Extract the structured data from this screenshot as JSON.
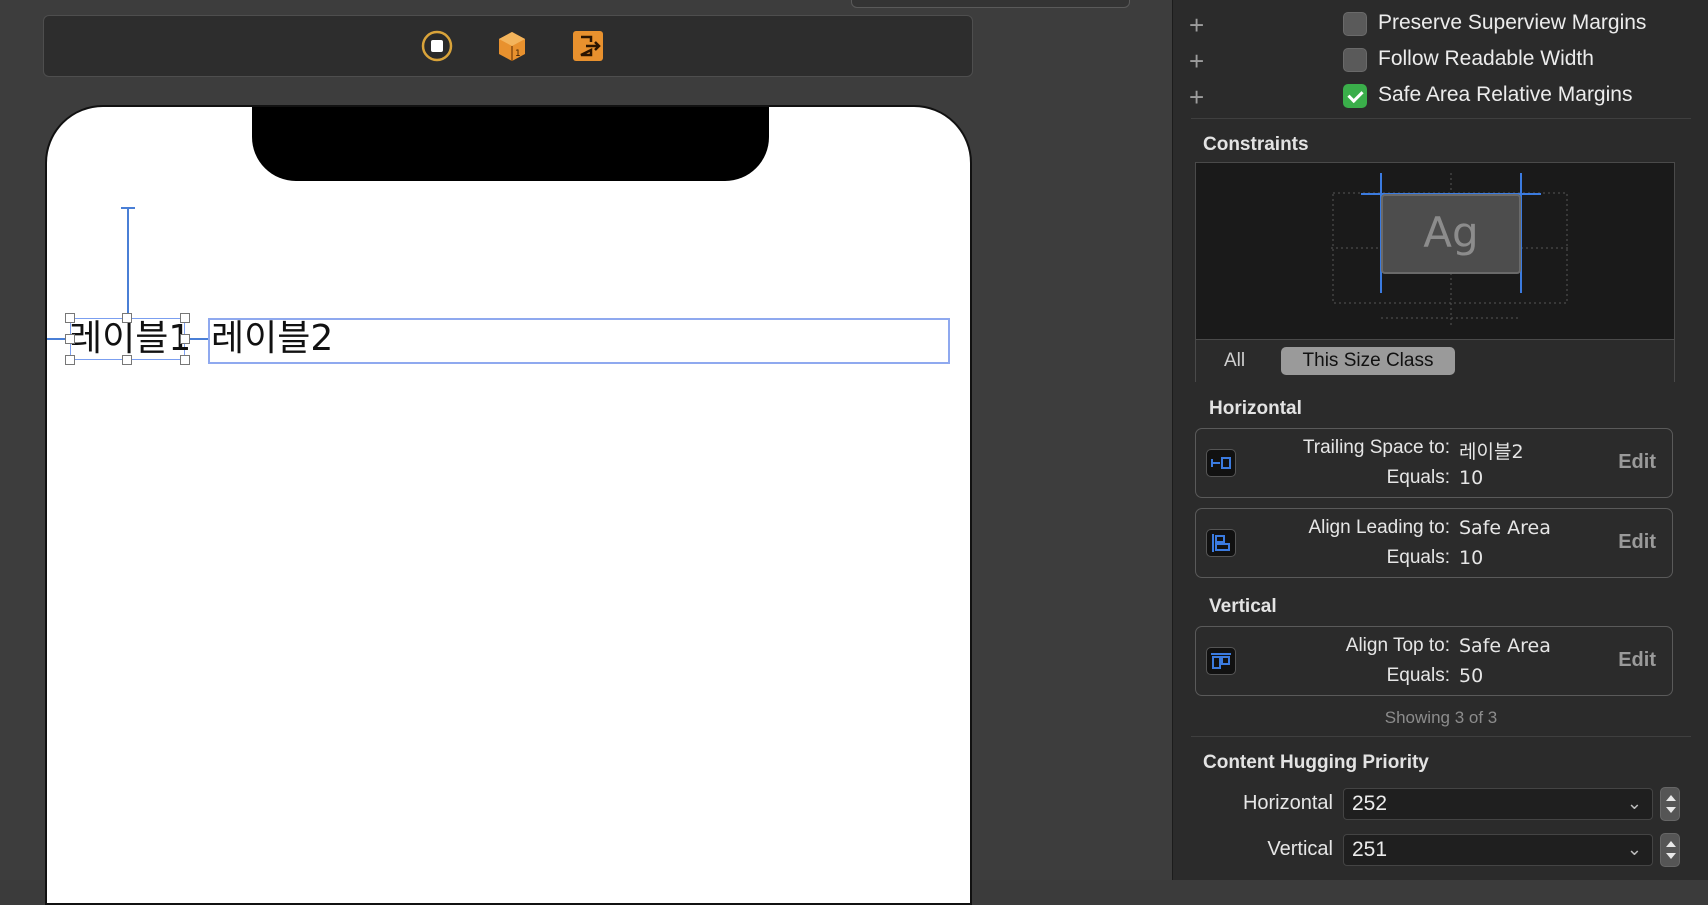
{
  "canvas": {
    "label1": "레이블1",
    "label2": "레이블2",
    "dock_icons": [
      "first-responder-icon",
      "object-icon",
      "exit-icon"
    ]
  },
  "inspector": {
    "layout_margins": [
      {
        "label": "Preserve Superview Margins",
        "checked": false
      },
      {
        "label": "Follow Readable Width",
        "checked": false
      },
      {
        "label": "Safe Area Relative Margins",
        "checked": true
      }
    ],
    "constraints_title": "Constraints",
    "preview_text": "Ag",
    "scope": {
      "all": "All",
      "size_class": "This Size Class",
      "selected": "This Size Class"
    },
    "horizontal_title": "Horizontal",
    "vertical_title": "Vertical",
    "horizontal": [
      {
        "key1": "Trailing Space to:",
        "val1": "레이블2",
        "key2": "Equals:",
        "val2": "10",
        "edit": "Edit",
        "icon": "trailing-space-icon"
      },
      {
        "key1": "Align Leading to:",
        "val1": "Safe Area",
        "key2": "Equals:",
        "val2": "10",
        "edit": "Edit",
        "icon": "align-leading-icon"
      }
    ],
    "vertical": [
      {
        "key1": "Align Top to:",
        "val1": "Safe Area",
        "key2": "Equals:",
        "val2": "50",
        "edit": "Edit",
        "icon": "align-top-icon"
      }
    ],
    "showing": "Showing 3 of 3",
    "hugging_title": "Content Hugging Priority",
    "hugging": {
      "horizontal_label": "Horizontal",
      "horizontal_value": "252",
      "vertical_label": "Vertical",
      "vertical_value": "251"
    },
    "colors": {
      "accent": "#4a7fd6",
      "check": "#3aae4a"
    }
  }
}
